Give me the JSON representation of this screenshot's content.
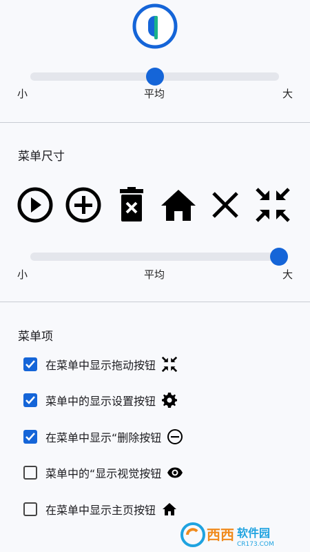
{
  "size_slider": {
    "value_fraction": 0.5,
    "label_small": "小",
    "label_mid": "平均",
    "label_large": "大"
  },
  "menu_size": {
    "title": "菜单尺寸",
    "icons": [
      "play-circle-icon",
      "add-circle-icon",
      "delete-icon",
      "home-icon",
      "close-icon",
      "collapse-icon"
    ],
    "slider": {
      "value_fraction": 1.0,
      "label_small": "小",
      "label_mid": "平均",
      "label_large": "大"
    }
  },
  "menu_items": {
    "title": "菜单项",
    "items": [
      {
        "label": "在菜单中显示拖动按钮",
        "checked": true,
        "icon": "collapse-icon"
      },
      {
        "label": "菜单中的显示设置按钮",
        "checked": true,
        "icon": "gear-icon"
      },
      {
        "label": "在菜单中显示“删除按钮",
        "checked": true,
        "icon": "minus-circle-icon"
      },
      {
        "label": "菜单中的“显示视觉按钮",
        "checked": false,
        "icon": "eye-icon"
      },
      {
        "label": "在菜单中显示主页按钮",
        "checked": false,
        "icon": "home-icon"
      }
    ]
  },
  "watermark": {
    "text": "西西软件园",
    "url_text": "CR173.COM"
  },
  "colors": {
    "accent": "#1565d8",
    "logo_green": "#1bb38a"
  }
}
